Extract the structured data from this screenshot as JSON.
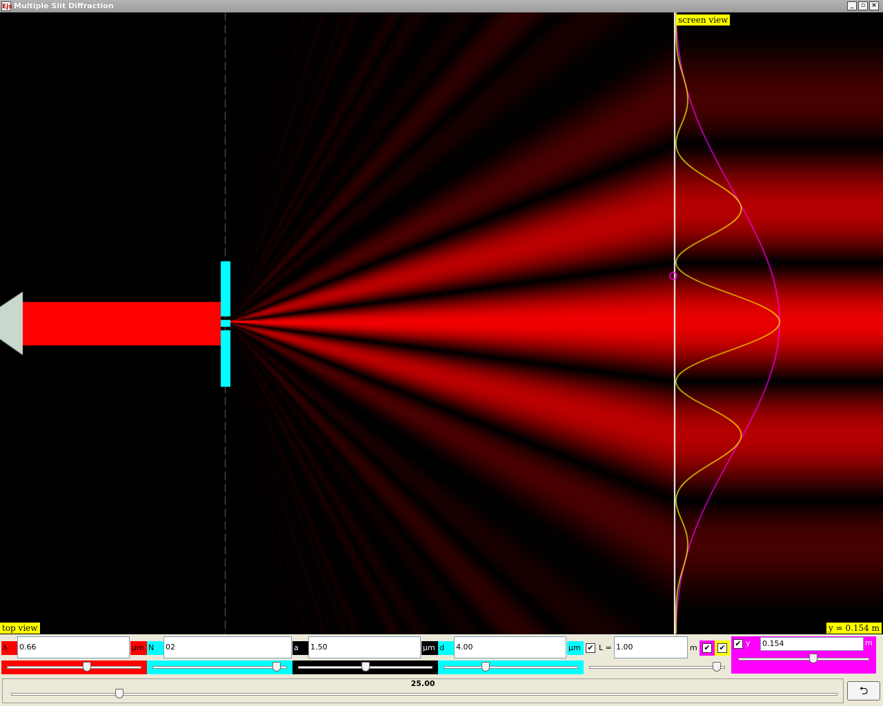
{
  "window": {
    "title": "Multiple Slit Diffraction",
    "icon_label": "Ejs",
    "buttons": [
      "_",
      "▫",
      "×"
    ]
  },
  "view": {
    "screen_view_label": "screen view",
    "top_view_label": "top view",
    "y_readout": "y = 0.154 m"
  },
  "simulation": {
    "wavelength_um": 0.66,
    "slit_count": 2,
    "slit_width_um": 1.5,
    "slit_spacing_um": 4.0,
    "screen_distance_m": 1.0,
    "y_m": 0.154,
    "beam_color": "#ff0000",
    "barrier_color": "#00ffff",
    "multi_slit_curve_color": "#ffff00",
    "single_slit_curve_color": "#ff00ff"
  },
  "controls": {
    "lambda": {
      "label": "λ =",
      "value": "0.66",
      "unit": "μm",
      "color": "#ff0000",
      "slider_level": 0.6
    },
    "n": {
      "label": "N =",
      "value": "02",
      "color": "#00ffff",
      "slider_level": 0.95
    },
    "a": {
      "label": "a =",
      "value": "1.50",
      "unit": "μm",
      "color": "#000000",
      "slider_level": 0.5
    },
    "d": {
      "label": "d =",
      "value": "4.00",
      "unit": "μm",
      "color": "#00ffff",
      "slider_level": 0.3
    },
    "l": {
      "label": "L =",
      "value": "1.00",
      "unit": "m",
      "checked": true,
      "slider_level": 0.97
    },
    "curve_checks": {
      "magenta": true,
      "yellow": true
    },
    "y": {
      "label": "y =",
      "value": "0.154",
      "unit": "m",
      "color": "#ff00ff",
      "checked": true,
      "slider_level": 0.58
    },
    "zoom": {
      "value": "25.00",
      "slider_level": 0.13
    }
  }
}
